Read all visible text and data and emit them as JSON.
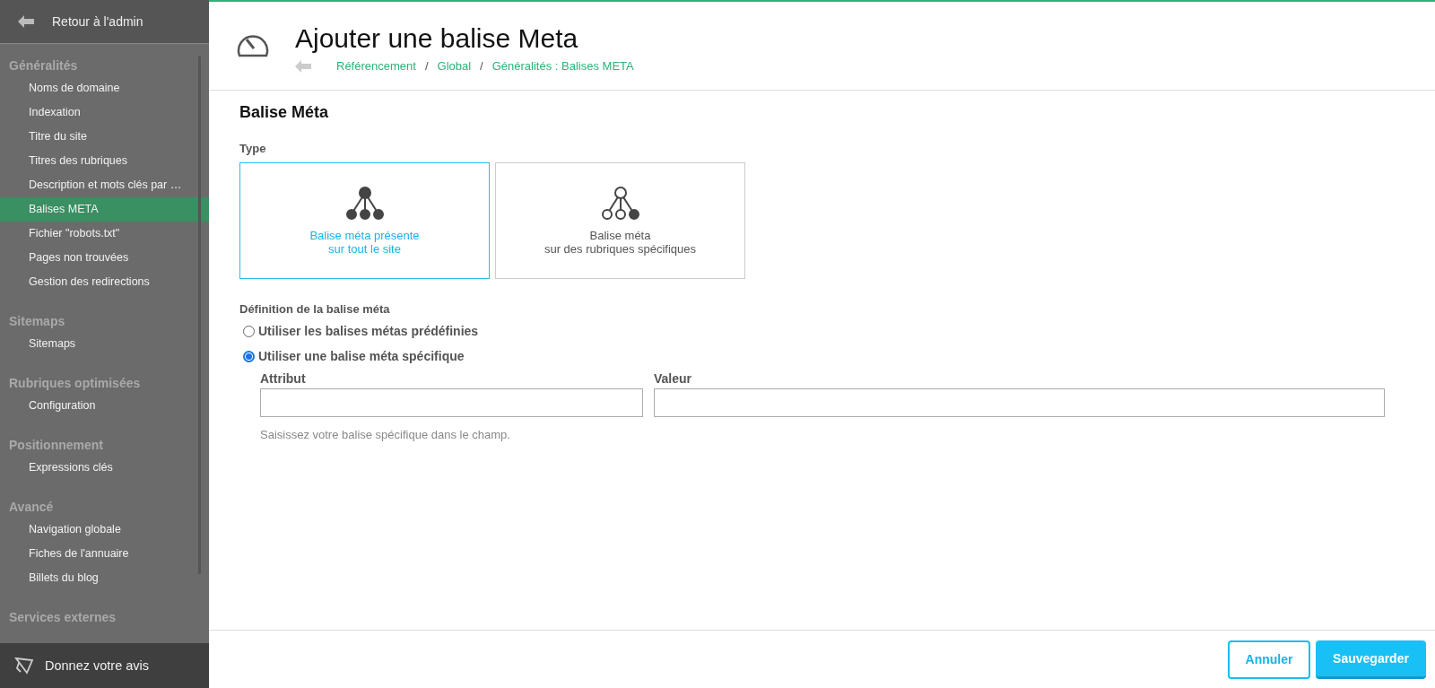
{
  "sidebar": {
    "back_link": "Retour à l'admin",
    "sections": [
      {
        "title": "Généralités",
        "items": [
          {
            "label": "Noms de domaine",
            "selected": false
          },
          {
            "label": "Indexation",
            "selected": false
          },
          {
            "label": "Titre du site",
            "selected": false
          },
          {
            "label": "Titres des rubriques",
            "selected": false
          },
          {
            "label": "Description et mots clés par …",
            "selected": false
          },
          {
            "label": "Balises META",
            "selected": true
          },
          {
            "label": "Fichier \"robots.txt\"",
            "selected": false
          },
          {
            "label": "Pages non trouvées",
            "selected": false
          },
          {
            "label": "Gestion des redirections",
            "selected": false
          }
        ]
      },
      {
        "title": "Sitemaps",
        "items": [
          {
            "label": "Sitemaps",
            "selected": false
          }
        ]
      },
      {
        "title": "Rubriques optimisées",
        "items": [
          {
            "label": "Configuration",
            "selected": false
          }
        ]
      },
      {
        "title": "Positionnement",
        "items": [
          {
            "label": "Expressions clés",
            "selected": false
          }
        ]
      },
      {
        "title": "Avancé",
        "items": [
          {
            "label": "Navigation globale",
            "selected": false
          },
          {
            "label": "Fiches de l'annuaire",
            "selected": false
          },
          {
            "label": "Billets du blog",
            "selected": false
          }
        ]
      },
      {
        "title": "Services externes"
      }
    ],
    "feedback": "Donnez votre avis"
  },
  "header": {
    "title": "Ajouter une balise Meta",
    "breadcrumb": [
      "Référencement",
      "Global",
      "Généralités : Balises META"
    ],
    "separator": "/"
  },
  "form": {
    "title": "Balise Méta",
    "type_label": "Type",
    "types": [
      {
        "kind": "all",
        "lines": [
          "Balise méta présente",
          "sur tout le site"
        ],
        "selected": true
      },
      {
        "kind": "specific",
        "lines": [
          "Balise méta",
          "sur des rubriques spécifiques"
        ],
        "selected": false
      }
    ],
    "definition_label": "Définition de la balise méta",
    "options": [
      {
        "label": "Utiliser les balises métas prédéfinies",
        "selected": false
      },
      {
        "label": "Utiliser une balise méta spécifique",
        "selected": true
      }
    ],
    "fields": [
      {
        "label": "Attribut"
      },
      {
        "label": "Valeur"
      }
    ],
    "help": "Saisissez votre balise spécifique dans le champ."
  },
  "footer": {
    "buttons": [
      {
        "label": "Annuler",
        "kind": "secondary"
      },
      {
        "label": "Sauvegarder",
        "kind": "primary"
      }
    ]
  }
}
